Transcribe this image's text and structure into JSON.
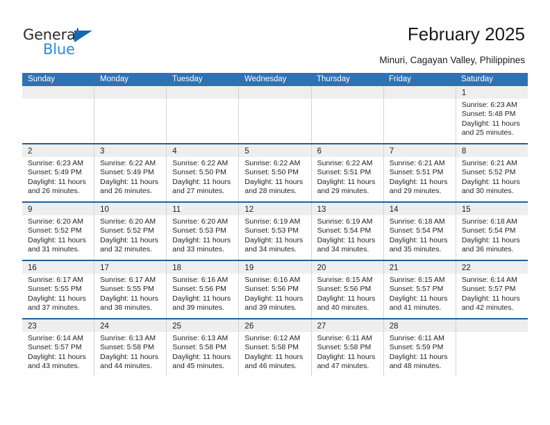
{
  "brand": {
    "name_top": "General",
    "name_bottom": "Blue",
    "triangle_color": "#1768b0",
    "blue_text_color": "#2e8ad6"
  },
  "header": {
    "title": "February 2025",
    "subtitle": "Minuri, Cagayan Valley, Philippines"
  },
  "theme": {
    "header_bg": "#3071b3",
    "week_divider": "#1d6098",
    "daynum_band": "#eeeeee",
    "cell_border": "#d3d3d3"
  },
  "weekdays": [
    "Sunday",
    "Monday",
    "Tuesday",
    "Wednesday",
    "Thursday",
    "Friday",
    "Saturday"
  ],
  "weeks": [
    [
      {
        "day": "",
        "blank": true
      },
      {
        "day": "",
        "blank": true
      },
      {
        "day": "",
        "blank": true
      },
      {
        "day": "",
        "blank": true
      },
      {
        "day": "",
        "blank": true
      },
      {
        "day": "",
        "blank": true
      },
      {
        "day": "1",
        "sunrise": "Sunrise: 6:23 AM",
        "sunset": "Sunset: 5:48 PM",
        "daylight1": "Daylight: 11 hours",
        "daylight2": "and 25 minutes."
      }
    ],
    [
      {
        "day": "2",
        "sunrise": "Sunrise: 6:23 AM",
        "sunset": "Sunset: 5:49 PM",
        "daylight1": "Daylight: 11 hours",
        "daylight2": "and 26 minutes."
      },
      {
        "day": "3",
        "sunrise": "Sunrise: 6:22 AM",
        "sunset": "Sunset: 5:49 PM",
        "daylight1": "Daylight: 11 hours",
        "daylight2": "and 26 minutes."
      },
      {
        "day": "4",
        "sunrise": "Sunrise: 6:22 AM",
        "sunset": "Sunset: 5:50 PM",
        "daylight1": "Daylight: 11 hours",
        "daylight2": "and 27 minutes."
      },
      {
        "day": "5",
        "sunrise": "Sunrise: 6:22 AM",
        "sunset": "Sunset: 5:50 PM",
        "daylight1": "Daylight: 11 hours",
        "daylight2": "and 28 minutes."
      },
      {
        "day": "6",
        "sunrise": "Sunrise: 6:22 AM",
        "sunset": "Sunset: 5:51 PM",
        "daylight1": "Daylight: 11 hours",
        "daylight2": "and 29 minutes."
      },
      {
        "day": "7",
        "sunrise": "Sunrise: 6:21 AM",
        "sunset": "Sunset: 5:51 PM",
        "daylight1": "Daylight: 11 hours",
        "daylight2": "and 29 minutes."
      },
      {
        "day": "8",
        "sunrise": "Sunrise: 6:21 AM",
        "sunset": "Sunset: 5:52 PM",
        "daylight1": "Daylight: 11 hours",
        "daylight2": "and 30 minutes."
      }
    ],
    [
      {
        "day": "9",
        "sunrise": "Sunrise: 6:20 AM",
        "sunset": "Sunset: 5:52 PM",
        "daylight1": "Daylight: 11 hours",
        "daylight2": "and 31 minutes."
      },
      {
        "day": "10",
        "sunrise": "Sunrise: 6:20 AM",
        "sunset": "Sunset: 5:52 PM",
        "daylight1": "Daylight: 11 hours",
        "daylight2": "and 32 minutes."
      },
      {
        "day": "11",
        "sunrise": "Sunrise: 6:20 AM",
        "sunset": "Sunset: 5:53 PM",
        "daylight1": "Daylight: 11 hours",
        "daylight2": "and 33 minutes."
      },
      {
        "day": "12",
        "sunrise": "Sunrise: 6:19 AM",
        "sunset": "Sunset: 5:53 PM",
        "daylight1": "Daylight: 11 hours",
        "daylight2": "and 34 minutes."
      },
      {
        "day": "13",
        "sunrise": "Sunrise: 6:19 AM",
        "sunset": "Sunset: 5:54 PM",
        "daylight1": "Daylight: 11 hours",
        "daylight2": "and 34 minutes."
      },
      {
        "day": "14",
        "sunrise": "Sunrise: 6:18 AM",
        "sunset": "Sunset: 5:54 PM",
        "daylight1": "Daylight: 11 hours",
        "daylight2": "and 35 minutes."
      },
      {
        "day": "15",
        "sunrise": "Sunrise: 6:18 AM",
        "sunset": "Sunset: 5:54 PM",
        "daylight1": "Daylight: 11 hours",
        "daylight2": "and 36 minutes."
      }
    ],
    [
      {
        "day": "16",
        "sunrise": "Sunrise: 6:17 AM",
        "sunset": "Sunset: 5:55 PM",
        "daylight1": "Daylight: 11 hours",
        "daylight2": "and 37 minutes."
      },
      {
        "day": "17",
        "sunrise": "Sunrise: 6:17 AM",
        "sunset": "Sunset: 5:55 PM",
        "daylight1": "Daylight: 11 hours",
        "daylight2": "and 38 minutes."
      },
      {
        "day": "18",
        "sunrise": "Sunrise: 6:16 AM",
        "sunset": "Sunset: 5:56 PM",
        "daylight1": "Daylight: 11 hours",
        "daylight2": "and 39 minutes."
      },
      {
        "day": "19",
        "sunrise": "Sunrise: 6:16 AM",
        "sunset": "Sunset: 5:56 PM",
        "daylight1": "Daylight: 11 hours",
        "daylight2": "and 39 minutes."
      },
      {
        "day": "20",
        "sunrise": "Sunrise: 6:15 AM",
        "sunset": "Sunset: 5:56 PM",
        "daylight1": "Daylight: 11 hours",
        "daylight2": "and 40 minutes."
      },
      {
        "day": "21",
        "sunrise": "Sunrise: 6:15 AM",
        "sunset": "Sunset: 5:57 PM",
        "daylight1": "Daylight: 11 hours",
        "daylight2": "and 41 minutes."
      },
      {
        "day": "22",
        "sunrise": "Sunrise: 6:14 AM",
        "sunset": "Sunset: 5:57 PM",
        "daylight1": "Daylight: 11 hours",
        "daylight2": "and 42 minutes."
      }
    ],
    [
      {
        "day": "23",
        "sunrise": "Sunrise: 6:14 AM",
        "sunset": "Sunset: 5:57 PM",
        "daylight1": "Daylight: 11 hours",
        "daylight2": "and 43 minutes."
      },
      {
        "day": "24",
        "sunrise": "Sunrise: 6:13 AM",
        "sunset": "Sunset: 5:58 PM",
        "daylight1": "Daylight: 11 hours",
        "daylight2": "and 44 minutes."
      },
      {
        "day": "25",
        "sunrise": "Sunrise: 6:13 AM",
        "sunset": "Sunset: 5:58 PM",
        "daylight1": "Daylight: 11 hours",
        "daylight2": "and 45 minutes."
      },
      {
        "day": "26",
        "sunrise": "Sunrise: 6:12 AM",
        "sunset": "Sunset: 5:58 PM",
        "daylight1": "Daylight: 11 hours",
        "daylight2": "and 46 minutes."
      },
      {
        "day": "27",
        "sunrise": "Sunrise: 6:11 AM",
        "sunset": "Sunset: 5:58 PM",
        "daylight1": "Daylight: 11 hours",
        "daylight2": "and 47 minutes."
      },
      {
        "day": "28",
        "sunrise": "Sunrise: 6:11 AM",
        "sunset": "Sunset: 5:59 PM",
        "daylight1": "Daylight: 11 hours",
        "daylight2": "and 48 minutes."
      },
      {
        "day": "",
        "blank": true
      }
    ]
  ]
}
